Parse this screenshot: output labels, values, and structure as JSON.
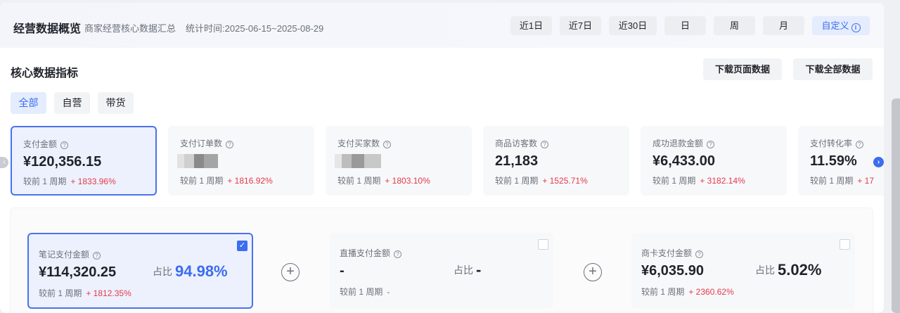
{
  "header": {
    "title": "经营数据概览",
    "subtitle": "商家经营核心数据汇总",
    "range_label": "统计时间:",
    "range_value": "2025-06-15~2025-08-29",
    "time_buttons": [
      "近1日",
      "近7日",
      "近30日",
      "日",
      "周",
      "月"
    ],
    "custom_label": "自定义",
    "custom_icon": "info-icon"
  },
  "section": {
    "title": "核心数据指标",
    "download_page": "下载页面数据",
    "download_all": "下载全部数据"
  },
  "filters": [
    "全部",
    "自营",
    "带货"
  ],
  "compare_label": "较前 1 周期",
  "metrics": [
    {
      "label": "支付金额",
      "value": "¥120,356.15",
      "change": "+ 1833.96%"
    },
    {
      "label": "支付订单数",
      "value": "",
      "change": "+ 1816.92%"
    },
    {
      "label": "支付买家数",
      "value": "",
      "change": "+ 1803.10%"
    },
    {
      "label": "商品访客数",
      "value": "21,183",
      "change": "+ 1525.71%"
    },
    {
      "label": "成功退款金额",
      "value": "¥6,433.00",
      "change": "+ 3182.14%"
    },
    {
      "label": "支付转化率",
      "value": "11.59%",
      "change": "+ 17"
    }
  ],
  "breakdown": {
    "share_label": "占比",
    "items": [
      {
        "label": "笔记支付金额",
        "value": "¥114,320.25",
        "share": "94.98%",
        "change": "+ 1812.35%",
        "checked": true
      },
      {
        "label": "直播支付金额",
        "value": "-",
        "share": "-",
        "change": "-",
        "checked": false
      },
      {
        "label": "商卡支付金额",
        "value": "¥6,035.90",
        "share": "5.02%",
        "change": "+ 2360.62%",
        "checked": false
      }
    ]
  },
  "colors": {
    "accent": "#3c6df0",
    "up": "#e5394b"
  }
}
